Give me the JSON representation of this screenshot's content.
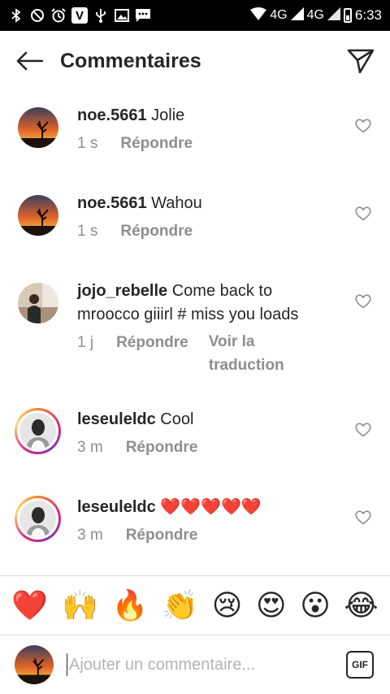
{
  "status_bar": {
    "left_icons": [
      "bluetooth-icon",
      "do-not-disturb-icon",
      "alarm-icon",
      "v-app-icon",
      "usb-icon",
      "gallery-icon",
      "messaging-icon"
    ],
    "network_1": "4G",
    "network_2": "4G",
    "time": "6:33"
  },
  "header": {
    "title": "Commentaires",
    "back_icon": "arrow-left-icon",
    "send_icon": "paper-plane-icon"
  },
  "comments": [
    {
      "user": "noe.5661",
      "text": "Jolie",
      "time": "1 s",
      "reply": "Répondre",
      "avatar": "sunset-tree",
      "story_ring": false
    },
    {
      "user": "noe.5661",
      "text": "Wahou",
      "time": "1 s",
      "reply": "Répondre",
      "avatar": "sunset-tree",
      "story_ring": false
    },
    {
      "user": "jojo_rebelle",
      "text": "Come back to mroocco giiirl # miss you loads",
      "time": "1 j",
      "reply": "Répondre",
      "translate": "Voir la traduction",
      "avatar": "person-photo",
      "story_ring": false
    },
    {
      "user": "leseuleldc",
      "text": "Cool",
      "time": "3 m",
      "reply": "Répondre",
      "avatar": "person-bw",
      "story_ring": true
    },
    {
      "user": "leseuleldc",
      "text": "❤️❤️❤️❤️❤️",
      "time": "3 m",
      "reply": "Répondre",
      "avatar": "person-bw",
      "story_ring": true
    }
  ],
  "emoji_bar": [
    "❤️",
    "🙌",
    "🔥",
    "👏",
    "😢",
    "😍",
    "😮",
    "😂"
  ],
  "input": {
    "placeholder": "Ajouter un commentaire...",
    "gif_label": "GIF"
  },
  "colors": {
    "text": "#262626",
    "meta": "#8e8e8e",
    "divider": "#dbdbdb"
  }
}
